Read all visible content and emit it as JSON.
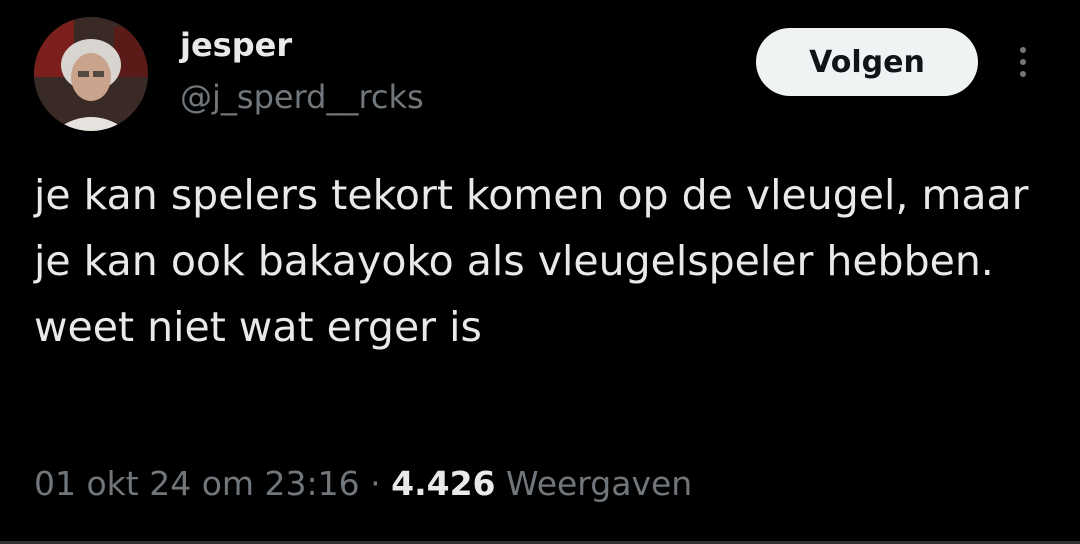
{
  "user": {
    "display_name": "jesper",
    "handle": "@j_sperd__rcks"
  },
  "actions": {
    "follow_label": "Volgen",
    "more_icon": "more-vertical-icon"
  },
  "tweet": {
    "text": "je kan spelers tekort komen op de vleugel, maar je kan ook bakayoko als vleugelspeler hebben. weet niet wat erger is",
    "date": "01 okt 24 om 23:16",
    "separator": " · ",
    "views_count": "4.426",
    "views_label": "Weergaven"
  },
  "colors": {
    "background": "#000000",
    "text_primary": "#e7e9ea",
    "text_secondary": "#71767b",
    "button_bg": "#eff3f4",
    "button_text": "#0f1419"
  }
}
